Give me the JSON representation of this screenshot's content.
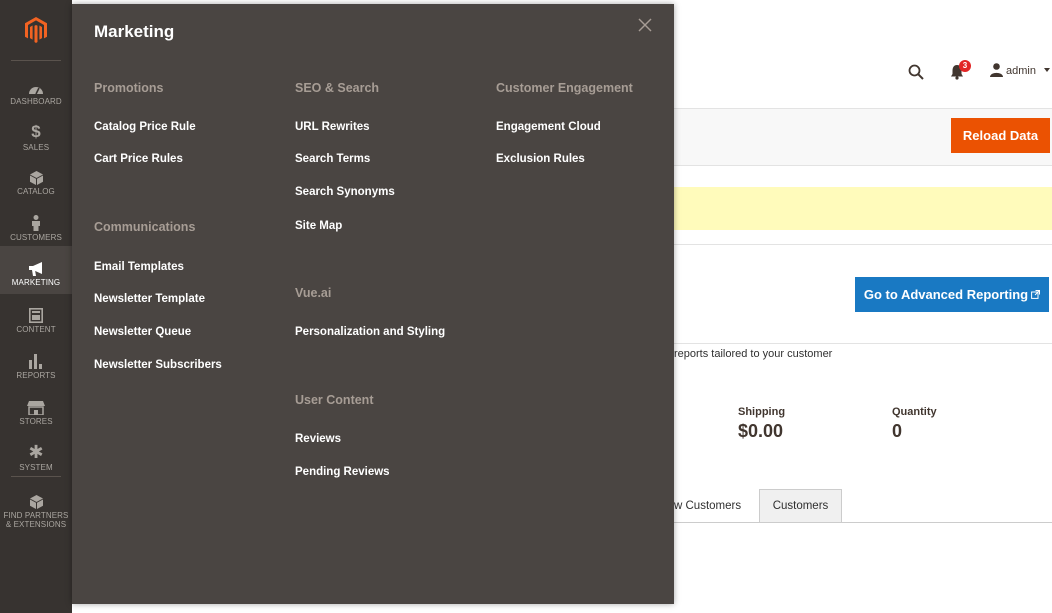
{
  "sidebar": {
    "items": [
      {
        "label": "Dashboard",
        "icon": "speedometer-icon"
      },
      {
        "label": "Sales",
        "icon": "dollar-icon"
      },
      {
        "label": "Catalog",
        "icon": "cube-icon"
      },
      {
        "label": "Customers",
        "icon": "person-icon"
      },
      {
        "label": "Marketing",
        "icon": "megaphone-icon"
      },
      {
        "label": "Content",
        "icon": "content-icon"
      },
      {
        "label": "Reports",
        "icon": "bar-chart-icon"
      },
      {
        "label": "Stores",
        "icon": "storefront-icon"
      },
      {
        "label": "System",
        "icon": "gear-icon"
      },
      {
        "label": "Find Partners & Extensions",
        "icon": "box-icon"
      }
    ]
  },
  "header": {
    "notifications_count": "3",
    "user": "admin"
  },
  "toolbar": {
    "reload_label": "Reload Data"
  },
  "advanced_reporting": {
    "text": "reports tailored to your customer",
    "button_label": "Go to Advanced Reporting"
  },
  "stats": [
    {
      "label": "Shipping",
      "value": "$0.00"
    },
    {
      "label": "Quantity",
      "value": "0"
    }
  ],
  "tabs": [
    {
      "label": "w Customers"
    },
    {
      "label": "Customers"
    }
  ],
  "flyout": {
    "title": "Marketing",
    "groups": [
      {
        "title": "Promotions",
        "items": [
          "Catalog Price Rule",
          "Cart Price Rules"
        ]
      },
      {
        "title": "Communications",
        "items": [
          "Email Templates",
          "Newsletter Template",
          "Newsletter Queue",
          "Newsletter Subscribers"
        ]
      },
      {
        "title": "SEO & Search",
        "items": [
          "URL Rewrites",
          "Search Terms",
          "Search Synonyms",
          "Site Map"
        ]
      },
      {
        "title": "Vue.ai",
        "items": [
          "Personalization and Styling"
        ]
      },
      {
        "title": "User Content",
        "items": [
          "Reviews",
          "Pending Reviews"
        ]
      },
      {
        "title": "Customer Engagement",
        "items": [
          "Engagement Cloud",
          "Exclusion Rules"
        ]
      }
    ]
  },
  "colors": {
    "sidebar_bg": "#373330",
    "flyout_bg": "#4a4542",
    "group_title": "#a79d95",
    "accent_orange": "#eb5202",
    "accent_blue": "#1979c3",
    "logo_orange": "#f26322",
    "notice_yellow": "#fffbbb"
  }
}
